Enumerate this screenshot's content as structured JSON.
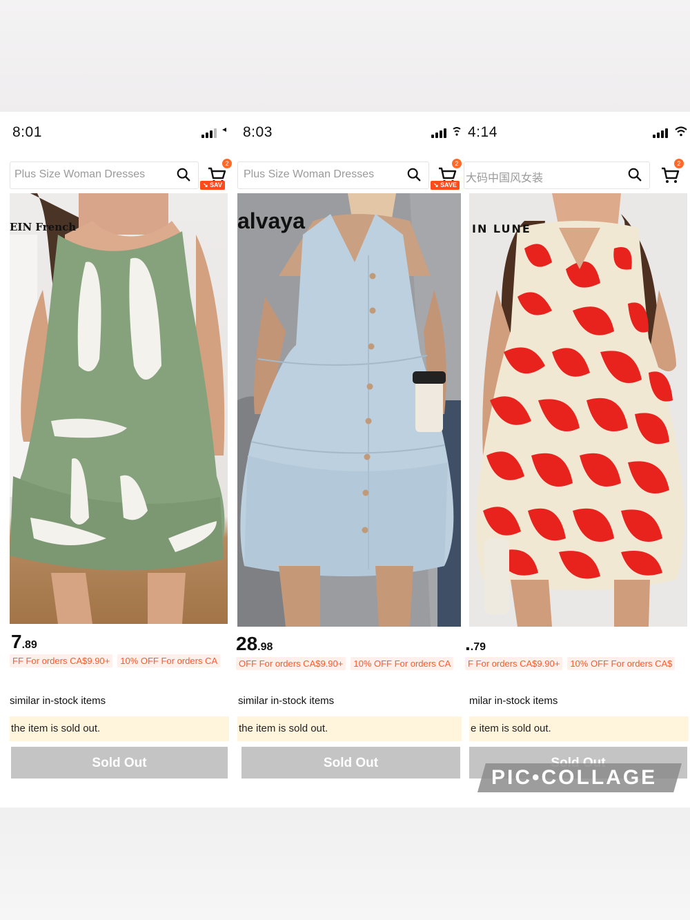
{
  "watermark": "PIC•COLLAGE",
  "search_placeholder": "Plus Size Woman Dresses",
  "sold_out_label": "Sold Out",
  "panels": [
    {
      "time": "8:01",
      "search_placeholder": "Plus Size Woman Dresses",
      "cart_count": "2",
      "save_tag": "SAV",
      "brand": "EIN French",
      "price_main": "7",
      "price_cents": ".89",
      "promos": [
        "FF For orders CA$9.90+",
        "10% OFF For orders CA"
      ],
      "similar": "similar in-stock items",
      "sold_note": "the item is sold out.",
      "sold_btn": "Sold Out",
      "dress_color": "#86a27d"
    },
    {
      "time": "8:03",
      "search_placeholder": "Plus Size Woman Dresses",
      "cart_count": "2",
      "save_tag": "SAVE",
      "brand": "alvaya",
      "price_main": "28",
      "price_cents": ".98",
      "promos": [
        "OFF For orders CA$9.90+",
        "10% OFF For orders CA"
      ],
      "similar": "similar in-stock items",
      "sold_note": "the item is sold out.",
      "sold_btn": "Sold Out",
      "dress_color": "#bcd0df"
    },
    {
      "time": "4:14",
      "search_placeholder": "大码中国风女装",
      "cart_count": "2",
      "brand": "IN  LUNE",
      "price_main": ".",
      "price_cents": ".79",
      "promos": [
        "F For orders CA$9.90+",
        "10% OFF For orders CA$"
      ],
      "similar": "milar in-stock items",
      "sold_note": "e item is sold out.",
      "sold_btn": "Sold Out",
      "dress_color": "#e8221d"
    }
  ]
}
